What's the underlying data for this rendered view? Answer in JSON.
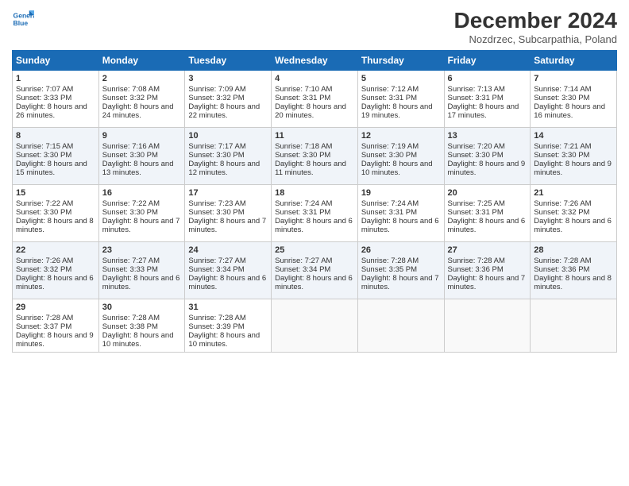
{
  "header": {
    "logo_line1": "General",
    "logo_line2": "Blue",
    "title": "December 2024",
    "subtitle": "Nozdrzec, Subcarpathia, Poland"
  },
  "days_of_week": [
    "Sunday",
    "Monday",
    "Tuesday",
    "Wednesday",
    "Thursday",
    "Friday",
    "Saturday"
  ],
  "weeks": [
    [
      {
        "day": "1",
        "rise": "Sunrise: 7:07 AM",
        "set": "Sunset: 3:33 PM",
        "daylight": "Daylight: 8 hours and 26 minutes."
      },
      {
        "day": "2",
        "rise": "Sunrise: 7:08 AM",
        "set": "Sunset: 3:32 PM",
        "daylight": "Daylight: 8 hours and 24 minutes."
      },
      {
        "day": "3",
        "rise": "Sunrise: 7:09 AM",
        "set": "Sunset: 3:32 PM",
        "daylight": "Daylight: 8 hours and 22 minutes."
      },
      {
        "day": "4",
        "rise": "Sunrise: 7:10 AM",
        "set": "Sunset: 3:31 PM",
        "daylight": "Daylight: 8 hours and 20 minutes."
      },
      {
        "day": "5",
        "rise": "Sunrise: 7:12 AM",
        "set": "Sunset: 3:31 PM",
        "daylight": "Daylight: 8 hours and 19 minutes."
      },
      {
        "day": "6",
        "rise": "Sunrise: 7:13 AM",
        "set": "Sunset: 3:31 PM",
        "daylight": "Daylight: 8 hours and 17 minutes."
      },
      {
        "day": "7",
        "rise": "Sunrise: 7:14 AM",
        "set": "Sunset: 3:30 PM",
        "daylight": "Daylight: 8 hours and 16 minutes."
      }
    ],
    [
      {
        "day": "8",
        "rise": "Sunrise: 7:15 AM",
        "set": "Sunset: 3:30 PM",
        "daylight": "Daylight: 8 hours and 15 minutes."
      },
      {
        "day": "9",
        "rise": "Sunrise: 7:16 AM",
        "set": "Sunset: 3:30 PM",
        "daylight": "Daylight: 8 hours and 13 minutes."
      },
      {
        "day": "10",
        "rise": "Sunrise: 7:17 AM",
        "set": "Sunset: 3:30 PM",
        "daylight": "Daylight: 8 hours and 12 minutes."
      },
      {
        "day": "11",
        "rise": "Sunrise: 7:18 AM",
        "set": "Sunset: 3:30 PM",
        "daylight": "Daylight: 8 hours and 11 minutes."
      },
      {
        "day": "12",
        "rise": "Sunrise: 7:19 AM",
        "set": "Sunset: 3:30 PM",
        "daylight": "Daylight: 8 hours and 10 minutes."
      },
      {
        "day": "13",
        "rise": "Sunrise: 7:20 AM",
        "set": "Sunset: 3:30 PM",
        "daylight": "Daylight: 8 hours and 9 minutes."
      },
      {
        "day": "14",
        "rise": "Sunrise: 7:21 AM",
        "set": "Sunset: 3:30 PM",
        "daylight": "Daylight: 8 hours and 9 minutes."
      }
    ],
    [
      {
        "day": "15",
        "rise": "Sunrise: 7:22 AM",
        "set": "Sunset: 3:30 PM",
        "daylight": "Daylight: 8 hours and 8 minutes."
      },
      {
        "day": "16",
        "rise": "Sunrise: 7:22 AM",
        "set": "Sunset: 3:30 PM",
        "daylight": "Daylight: 8 hours and 7 minutes."
      },
      {
        "day": "17",
        "rise": "Sunrise: 7:23 AM",
        "set": "Sunset: 3:30 PM",
        "daylight": "Daylight: 8 hours and 7 minutes."
      },
      {
        "day": "18",
        "rise": "Sunrise: 7:24 AM",
        "set": "Sunset: 3:31 PM",
        "daylight": "Daylight: 8 hours and 6 minutes."
      },
      {
        "day": "19",
        "rise": "Sunrise: 7:24 AM",
        "set": "Sunset: 3:31 PM",
        "daylight": "Daylight: 8 hours and 6 minutes."
      },
      {
        "day": "20",
        "rise": "Sunrise: 7:25 AM",
        "set": "Sunset: 3:31 PM",
        "daylight": "Daylight: 8 hours and 6 minutes."
      },
      {
        "day": "21",
        "rise": "Sunrise: 7:26 AM",
        "set": "Sunset: 3:32 PM",
        "daylight": "Daylight: 8 hours and 6 minutes."
      }
    ],
    [
      {
        "day": "22",
        "rise": "Sunrise: 7:26 AM",
        "set": "Sunset: 3:32 PM",
        "daylight": "Daylight: 8 hours and 6 minutes."
      },
      {
        "day": "23",
        "rise": "Sunrise: 7:27 AM",
        "set": "Sunset: 3:33 PM",
        "daylight": "Daylight: 8 hours and 6 minutes."
      },
      {
        "day": "24",
        "rise": "Sunrise: 7:27 AM",
        "set": "Sunset: 3:34 PM",
        "daylight": "Daylight: 8 hours and 6 minutes."
      },
      {
        "day": "25",
        "rise": "Sunrise: 7:27 AM",
        "set": "Sunset: 3:34 PM",
        "daylight": "Daylight: 8 hours and 6 minutes."
      },
      {
        "day": "26",
        "rise": "Sunrise: 7:28 AM",
        "set": "Sunset: 3:35 PM",
        "daylight": "Daylight: 8 hours and 7 minutes."
      },
      {
        "day": "27",
        "rise": "Sunrise: 7:28 AM",
        "set": "Sunset: 3:36 PM",
        "daylight": "Daylight: 8 hours and 7 minutes."
      },
      {
        "day": "28",
        "rise": "Sunrise: 7:28 AM",
        "set": "Sunset: 3:36 PM",
        "daylight": "Daylight: 8 hours and 8 minutes."
      }
    ],
    [
      {
        "day": "29",
        "rise": "Sunrise: 7:28 AM",
        "set": "Sunset: 3:37 PM",
        "daylight": "Daylight: 8 hours and 9 minutes."
      },
      {
        "day": "30",
        "rise": "Sunrise: 7:28 AM",
        "set": "Sunset: 3:38 PM",
        "daylight": "Daylight: 8 hours and 10 minutes."
      },
      {
        "day": "31",
        "rise": "Sunrise: 7:28 AM",
        "set": "Sunset: 3:39 PM",
        "daylight": "Daylight: 8 hours and 10 minutes."
      },
      null,
      null,
      null,
      null
    ]
  ]
}
